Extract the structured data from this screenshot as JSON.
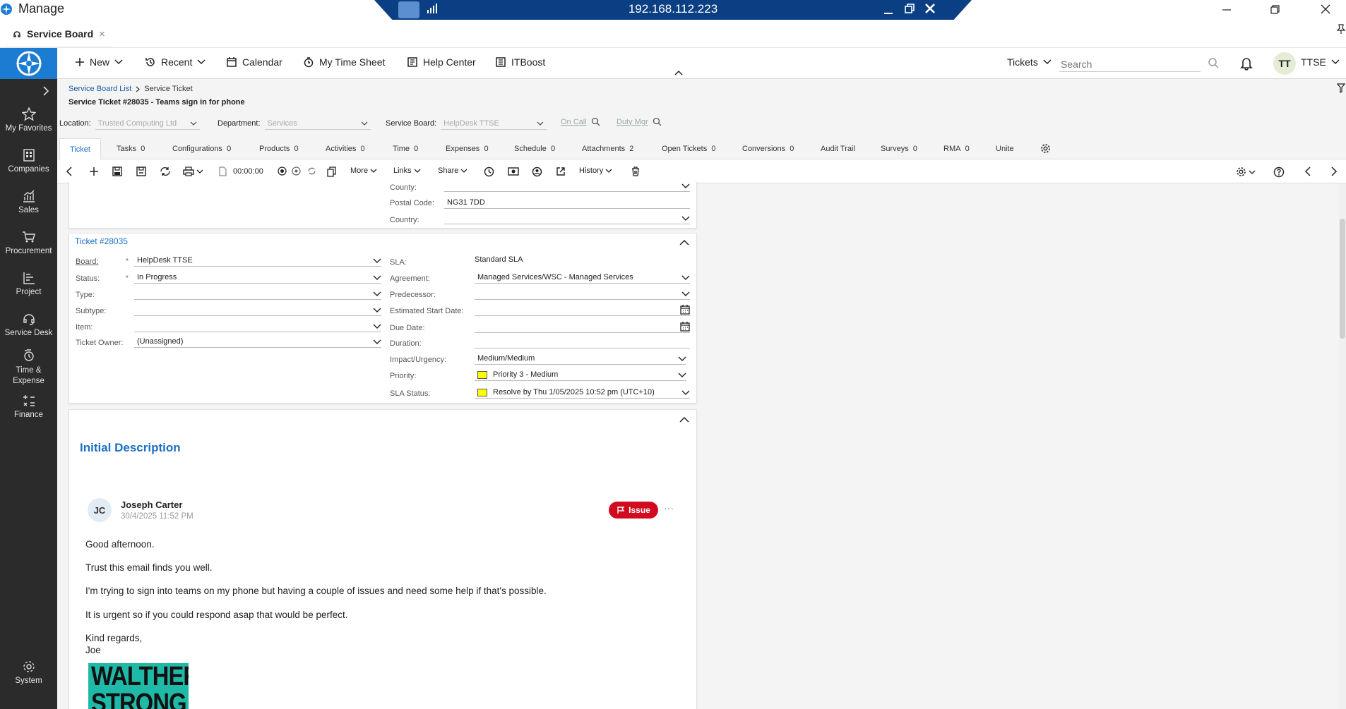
{
  "window": {
    "title": "Manage",
    "remote_host": "192.168.112.223"
  },
  "app_tab": {
    "label": "Service Board",
    "close": "×"
  },
  "nav": {
    "items": [
      {
        "label": "My Favorites",
        "icon": "star-icon"
      },
      {
        "label": "Companies",
        "icon": "building-icon"
      },
      {
        "label": "Sales",
        "icon": "chart-icon"
      },
      {
        "label": "Procurement",
        "icon": "cart-icon"
      },
      {
        "label": "Project",
        "icon": "project-icon"
      },
      {
        "label": "Service Desk",
        "icon": "headset-icon"
      },
      {
        "label": "Time & Expense",
        "icon": "timer-icon"
      },
      {
        "label": "Finance",
        "icon": "finance-icon"
      },
      {
        "label": "System",
        "icon": "gear-icon"
      }
    ]
  },
  "toolbar": {
    "new": "New",
    "recent": "Recent",
    "calendar": "Calendar",
    "timesheet": "My Time Sheet",
    "helpcenter": "Help Center",
    "itboost": "ITBoost",
    "tickets": "Tickets",
    "search_placeholder": "Search",
    "avatar_initials": "TT",
    "user": "TTSE"
  },
  "breadcrumb": {
    "parent": "Service Board List",
    "current": "Service Ticket"
  },
  "page_title": "Service Ticket #28035 - Teams sign in for phone",
  "filters": {
    "location_label": "Location:",
    "location_value": "Trusted Computing Ltd",
    "department_label": "Department:",
    "department_value": "Services",
    "board_label": "Service Board:",
    "board_value": "HelpDesk TTSE",
    "on_call": "On Call",
    "duty_mgr": "Duty Mgr"
  },
  "ticket_tabs": [
    {
      "label": "Ticket",
      "count": ""
    },
    {
      "label": "Tasks",
      "count": "0"
    },
    {
      "label": "Configurations",
      "count": "0"
    },
    {
      "label": "Products",
      "count": "0"
    },
    {
      "label": "Activities",
      "count": "0"
    },
    {
      "label": "Time",
      "count": "0"
    },
    {
      "label": "Expenses",
      "count": "0"
    },
    {
      "label": "Schedule",
      "count": "0"
    },
    {
      "label": "Attachments",
      "count": "2"
    },
    {
      "label": "Open Tickets",
      "count": "0"
    },
    {
      "label": "Conversions",
      "count": "0"
    },
    {
      "label": "Audit Trail",
      "count": ""
    },
    {
      "label": "Surveys",
      "count": "0"
    },
    {
      "label": "RMA",
      "count": "0"
    },
    {
      "label": "Unite",
      "count": ""
    }
  ],
  "actions": {
    "timer": "00:00:00",
    "more": "More",
    "links": "Links",
    "share": "Share",
    "history": "History"
  },
  "address": {
    "county_label": "County:",
    "county_value": "",
    "postal_label": "Postal Code:",
    "postal_value": "NG31 7DD",
    "country_label": "Country:",
    "country_value": ""
  },
  "ticket": {
    "section_title": "Ticket #28035",
    "board_label": "Board:",
    "board_value": "HelpDesk TTSE",
    "status_label": "Status:",
    "status_value": "In Progress",
    "type_label": "Type:",
    "type_value": "",
    "subtype_label": "Subtype:",
    "subtype_value": "",
    "item_label": "Item:",
    "item_value": "",
    "owner_label": "Ticket Owner:",
    "owner_value": "(Unassigned)",
    "sla_label": "SLA:",
    "sla_value": "Standard SLA",
    "agreement_label": "Agreement:",
    "agreement_value": "Managed Services/WSC - Managed Services",
    "predecessor_label": "Predecessor:",
    "predecessor_value": "",
    "est_start_label": "Estimated Start Date:",
    "est_start_value": "",
    "due_label": "Due Date:",
    "due_value": "",
    "duration_label": "Duration:",
    "duration_value": "",
    "impact_label": "Impact/Urgency:",
    "impact_value": "Medium/Medium",
    "priority_label": "Priority:",
    "priority_value": "Priority 3 - Medium",
    "sla_status_label": "SLA Status:",
    "sla_status_value": "Resolve by Thu 1/05/2025 10:52 pm (UTC+10)",
    "required_mark": "*"
  },
  "description": {
    "title": "Initial Description",
    "author_initials": "JC",
    "author": "Joseph Carter",
    "timestamp": "30/4/2025 11:52 PM",
    "badge": "Issue",
    "menu": "···",
    "lines": [
      "Good afternoon.",
      "Trust this email finds you well.",
      "I'm trying to sign into teams on my phone but having a couple of issues and need some help if that's possible.",
      "It is urgent so if you could respond asap that would be perfect.",
      "Kind regards,",
      "Joe"
    ],
    "signature_logo_line1": "WALTHER",
    "signature_logo_line2": "STRONG"
  },
  "colors": {
    "accent": "#1c6fc4",
    "nav_bg": "#2b2b2b",
    "logo_bg": "#1c7cd1",
    "issue_red": "#d10a1f",
    "priority_yellow": "#ffff00",
    "rdp_blue": "#0b3f84"
  }
}
